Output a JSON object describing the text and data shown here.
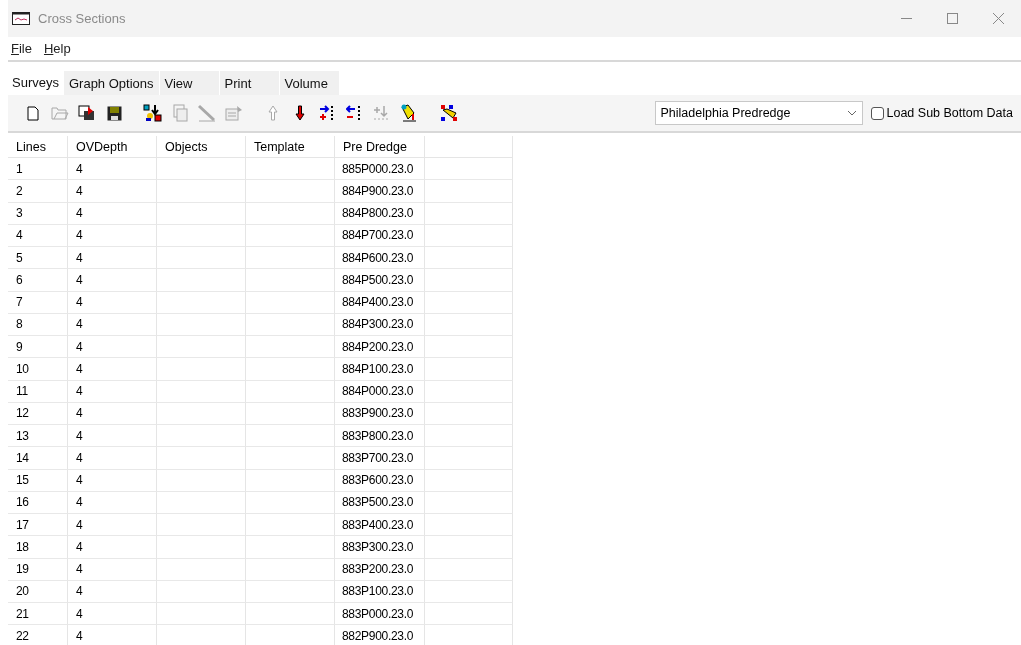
{
  "window": {
    "title": "Cross Sections"
  },
  "menu": [
    {
      "label": "File"
    },
    {
      "label": "Help"
    }
  ],
  "tabs": [
    {
      "label": "Surveys",
      "selected": true
    },
    {
      "label": "Graph Options",
      "selected": false
    },
    {
      "label": "View",
      "selected": false
    },
    {
      "label": "Print",
      "selected": false
    },
    {
      "label": "Volume",
      "selected": false
    }
  ],
  "toolbar": [
    {
      "kind": "new",
      "disabled": false
    },
    {
      "kind": "open",
      "disabled": true
    },
    {
      "kind": "import",
      "disabled": false
    },
    {
      "kind": "save",
      "disabled": false
    },
    {
      "kind": "gap"
    },
    {
      "kind": "objects",
      "disabled": false
    },
    {
      "kind": "copy",
      "disabled": true
    },
    {
      "kind": "pencil",
      "disabled": true
    },
    {
      "kind": "properties",
      "disabled": true
    },
    {
      "kind": "gap"
    },
    {
      "kind": "up",
      "disabled": true
    },
    {
      "kind": "down",
      "disabled": false
    },
    {
      "kind": "add-column",
      "disabled": false
    },
    {
      "kind": "remove-column",
      "disabled": false
    },
    {
      "kind": "sort",
      "disabled": true
    },
    {
      "kind": "paint",
      "disabled": false
    },
    {
      "kind": "gap"
    },
    {
      "kind": "colors",
      "disabled": false
    }
  ],
  "survey_select": {
    "value": "Philadelphia Predredge"
  },
  "load_sub_bottom": {
    "label": "Load Sub Bottom Data",
    "checked": false
  },
  "table": {
    "columns": [
      "Lines",
      "OVDepth",
      "Objects",
      "Template",
      "Pre Dredge"
    ],
    "rows": [
      {
        "lines": "1",
        "ov_depth": "4",
        "pre_dredge": "885P000.23.0"
      },
      {
        "lines": "2",
        "ov_depth": "4",
        "pre_dredge": "884P900.23.0"
      },
      {
        "lines": "3",
        "ov_depth": "4",
        "pre_dredge": "884P800.23.0"
      },
      {
        "lines": "4",
        "ov_depth": "4",
        "pre_dredge": "884P700.23.0"
      },
      {
        "lines": "5",
        "ov_depth": "4",
        "pre_dredge": "884P600.23.0"
      },
      {
        "lines": "6",
        "ov_depth": "4",
        "pre_dredge": "884P500.23.0"
      },
      {
        "lines": "7",
        "ov_depth": "4",
        "pre_dredge": "884P400.23.0"
      },
      {
        "lines": "8",
        "ov_depth": "4",
        "pre_dredge": "884P300.23.0"
      },
      {
        "lines": "9",
        "ov_depth": "4",
        "pre_dredge": "884P200.23.0"
      },
      {
        "lines": "10",
        "ov_depth": "4",
        "pre_dredge": "884P100.23.0"
      },
      {
        "lines": "11",
        "ov_depth": "4",
        "pre_dredge": "884P000.23.0"
      },
      {
        "lines": "12",
        "ov_depth": "4",
        "pre_dredge": "883P900.23.0"
      },
      {
        "lines": "13",
        "ov_depth": "4",
        "pre_dredge": "883P800.23.0"
      },
      {
        "lines": "14",
        "ov_depth": "4",
        "pre_dredge": "883P700.23.0"
      },
      {
        "lines": "15",
        "ov_depth": "4",
        "pre_dredge": "883P600.23.0"
      },
      {
        "lines": "16",
        "ov_depth": "4",
        "pre_dredge": "883P500.23.0"
      },
      {
        "lines": "17",
        "ov_depth": "4",
        "pre_dredge": "883P400.23.0"
      },
      {
        "lines": "18",
        "ov_depth": "4",
        "pre_dredge": "883P300.23.0"
      },
      {
        "lines": "19",
        "ov_depth": "4",
        "pre_dredge": "883P200.23.0"
      },
      {
        "lines": "20",
        "ov_depth": "4",
        "pre_dredge": "883P100.23.0"
      },
      {
        "lines": "21",
        "ov_depth": "4",
        "pre_dredge": "883P000.23.0"
      },
      {
        "lines": "22",
        "ov_depth": "4",
        "pre_dredge": "882P900.23.0"
      }
    ]
  }
}
